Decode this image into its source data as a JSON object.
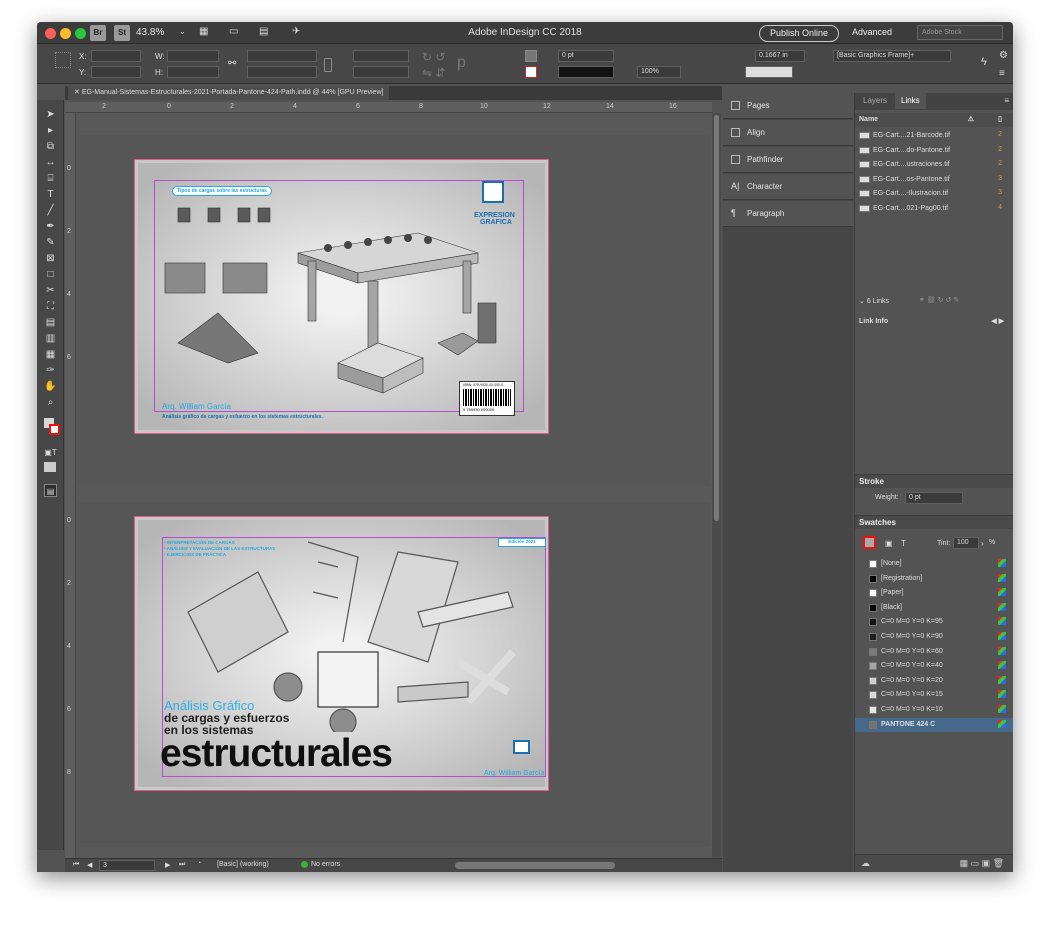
{
  "app": {
    "title": "Adobe InDesign CC 2018",
    "zoom": "43.8%",
    "bridge": "Br",
    "stock_btn": "St",
    "publish": "Publish Online",
    "workspace": "Advanced",
    "search_placeholder": "Adobe Stock"
  },
  "control": {
    "x_label": "X:",
    "y_label": "Y:",
    "w_label": "W:",
    "h_label": "H:",
    "stroke_weight": "0 pt",
    "scale": "100%",
    "offset": "0.1667 in",
    "frame_style": "[Basic Graphics Frame]+"
  },
  "document": {
    "tab": "EG-Manual-Sistemas-Estructurales-2021-Portada-Pantone-424-Path.indd @ 44% [GPU Preview]"
  },
  "ruler": {
    "h": [
      "2",
      "0",
      "2",
      "4",
      "6",
      "8",
      "10",
      "12",
      "14",
      "16"
    ],
    "v1": [
      "0",
      "2",
      "4",
      "6"
    ],
    "v2": [
      "0",
      "2",
      "4",
      "6",
      "8"
    ]
  },
  "cover_back": {
    "title": "Tipos de cargas sobre las estructuras",
    "brand1": "EXPRESION",
    "brand2": "GRAFICA",
    "author": "Arq. William García",
    "subtitle": "Análisis gráfico de cargas y esfuerzo en los sistemas estructurales.",
    "isbn": "ISBN: 978-9930-00-000-0",
    "barcode_digits": "9 789930 000000"
  },
  "cover_front": {
    "title1": "Análisis Gráfico",
    "title2": "de cargas y esfuerzos",
    "title3": "en los sistemas",
    "title4": "estructurales",
    "edition": "Edición 2021",
    "bullet1": "• INTERPRETACIÓN DE CARGAS",
    "bullet2": "• ANÁLISIS Y EVALUACIÓN DE LAS ESTRUCTURAS",
    "bullet3": "• EJERCICIOS DE PRÁCTICA",
    "author": "Arq. William García"
  },
  "status": {
    "page": "3",
    "preflight_profile": "[Basic] (working)",
    "errors": "No errors"
  },
  "mid_panels": [
    "Pages",
    "Align",
    "Pathfinder",
    "Character",
    "Paragraph"
  ],
  "links_panel": {
    "tabs": [
      "Layers",
      "Links"
    ],
    "name_header": "Name",
    "items": [
      {
        "name": "EG-Cart....21-Barcode.tif",
        "page": "2"
      },
      {
        "name": "EG-Cart....do-Pantone.tif",
        "page": "2"
      },
      {
        "name": "EG-Cart....ustraciones.tif",
        "page": "2"
      },
      {
        "name": "EG-Cart....os-Pantone.tif",
        "page": "3"
      },
      {
        "name": "EG-Cart....-Ilustracion.tif",
        "page": "3"
      },
      {
        "name": "EG-Cart....021-Pag00.tif",
        "page": "4"
      }
    ],
    "count": "6 Links",
    "info": "Link Info"
  },
  "stroke_panel": {
    "title": "Stroke",
    "weight_label": "Weight:",
    "weight": "0 pt"
  },
  "swatches_panel": {
    "title": "Swatches",
    "tint_label": "Tint:",
    "tint": "100",
    "tint_unit": "%",
    "items": [
      {
        "name": "[None]",
        "color": "#ffffff"
      },
      {
        "name": "[Registration]",
        "color": "#000000"
      },
      {
        "name": "[Paper]",
        "color": "#ffffff"
      },
      {
        "name": "[Black]",
        "color": "#000000"
      },
      {
        "name": "C=0 M=0 Y=0 K=95",
        "color": "#141414"
      },
      {
        "name": "C=0 M=0 Y=0 K=90",
        "color": "#1f1f1f"
      },
      {
        "name": "C=0 M=0 Y=0 K=60",
        "color": "#7a7a7a"
      },
      {
        "name": "C=0 M=0 Y=0 K=40",
        "color": "#a5a5a5"
      },
      {
        "name": "C=0 M=0 Y=0 K=20",
        "color": "#d0d0d0"
      },
      {
        "name": "C=0 M=0 Y=0 K=15",
        "color": "#dadada"
      },
      {
        "name": "C=0 M=0 Y=0 K=10",
        "color": "#e5e5e5"
      },
      {
        "name": "PANTONE 424 C",
        "color": "#707372"
      }
    ]
  }
}
